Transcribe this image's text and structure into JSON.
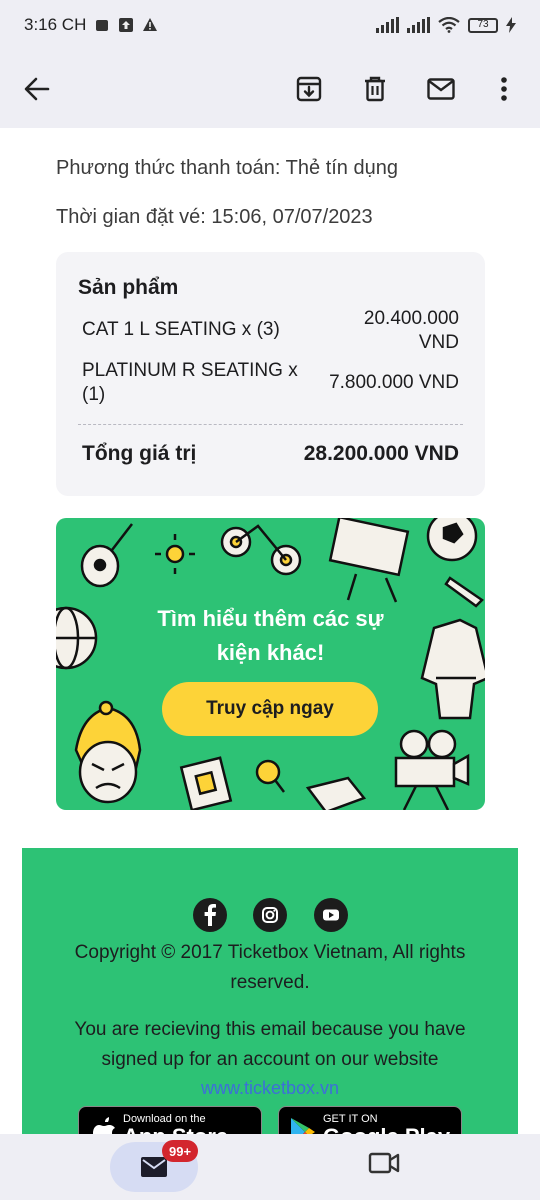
{
  "status_bar": {
    "time": "3:16 CH",
    "battery": "73"
  },
  "email": {
    "payment_method": "Phương thức thanh toán: Thẻ tín dụng",
    "booking_time": "Thời gian đặt vé: 15:06, 07/07/2023",
    "order": {
      "title": "Sản phẩm",
      "items": [
        {
          "name_line1": "CAT 1 L SEATING x (3)",
          "name_line2": "",
          "price_line1": "20.400.000",
          "price_line2": "VND"
        },
        {
          "name_line1": "PLATINUM R SEATING x",
          "name_line2": "(1)",
          "price_line1": "7.800.000 VND",
          "price_line2": ""
        }
      ],
      "total_label": "Tổng giá trị",
      "total_value": "28.200.000 VND"
    },
    "promo": {
      "text_line1": "Tìm hiểu thêm các sự",
      "text_line2": "kiện khác!",
      "button_label": "Truy cập ngay"
    },
    "footer": {
      "copyright_line1": "Copyright © 2017 Ticketbox Vietnam, All rights",
      "copyright_line2": "reserved.",
      "notice_line1": "You are recieving this email because you have",
      "notice_line2": "signed up for an account on our website",
      "website": "www.ticketbox.vn",
      "app_store_small": "Download on the",
      "app_store_big": "App Store",
      "google_play_small": "GET IT ON",
      "google_play_big": "Google Play"
    }
  },
  "bottom_nav": {
    "mail_badge": "99+"
  },
  "colors": {
    "ticketbox_green": "#2dc275",
    "button_yellow": "#fdd338",
    "badge_red": "#d3262e"
  }
}
